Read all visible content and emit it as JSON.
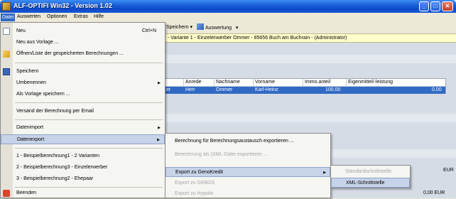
{
  "window": {
    "title": "ALF-OPTIFI Win32 - Version 1.02"
  },
  "menubar": {
    "items": [
      "Datei",
      "Auswerten",
      "Optionen",
      "Extras",
      "Hilfe"
    ]
  },
  "toolbar": {
    "save_label": "Speichern",
    "save_arrow": "▾",
    "evaluate_label": "Auswertung",
    "evaluate_arrow": "▾"
  },
  "infobar": {
    "text": "- Variante 1 - Einzelenwerber Ommer - 85656 Buch am Buchrain - (Administrator)"
  },
  "grid": {
    "columns": [
      "Anrede",
      "Nachname",
      "Vorname",
      "Immo.anteil",
      "Eigenmittel/-leistung"
    ],
    "row": {
      "prefix": "er",
      "anrede": "Herr",
      "nachname": "Ommer",
      "vorname": "Karl-Heinz",
      "immo": "100,00",
      "eigen": "0,00"
    }
  },
  "file_menu": {
    "new": {
      "label": "Neu",
      "shortcut": "Ctrl+N"
    },
    "new_template": "Neu aus Vorlage ...",
    "open_list": "Öffnen/Liste der gespeicherten Berechnungen ...",
    "save": "Speichern",
    "rename": "Umbenennen",
    "save_as_template": "Als Vorlage speichern ...",
    "send_email": "Versand der Berechnung per Email",
    "import": "Datenimport",
    "export": "Datenexport",
    "recent": [
      "1 - Beispielberechnung1 - 2 Varianten",
      "2 - Beispielberechnung3 - Einzelerwerber",
      "3 - Beispielberechnung2 - Ehepaar"
    ],
    "quit": "Beenden"
  },
  "export_submenu": {
    "items": [
      "Berechnung für Berechnungsaustausch exportieren ...",
      "Berechnung als (XML-Datei exportieren ...",
      "Export zu GenoKredit",
      "Export zu GEBOS",
      "Export zu Hypolix"
    ]
  },
  "genokredit_submenu": {
    "items": [
      "Standardschnittstelle",
      "XML-Schnittstelle"
    ]
  },
  "values": {
    "eur1": "EUR",
    "eur2": "0,00 EUR"
  },
  "colors": {
    "highlight": "#316ac5",
    "menu_hover": "#c7d3e8",
    "info_bg": "#ffffcc"
  }
}
